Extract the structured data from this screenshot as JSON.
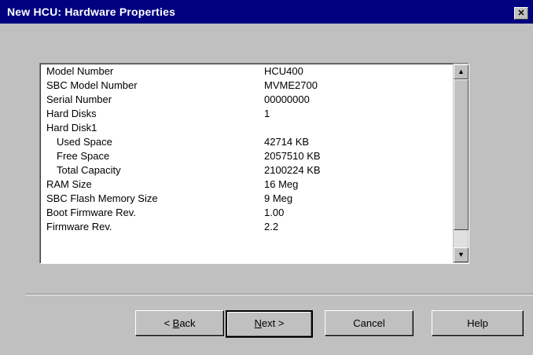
{
  "window": {
    "title": "New HCU: Hardware Properties",
    "close_label": "✕"
  },
  "properties": [
    {
      "label": "Model Number",
      "value": "HCU400",
      "indent": false
    },
    {
      "label": "SBC Model Number",
      "value": "MVME2700",
      "indent": false
    },
    {
      "label": "Serial Number",
      "value": "00000000",
      "indent": false
    },
    {
      "label": "Hard Disks",
      "value": "1",
      "indent": false
    },
    {
      "label": "Hard Disk1",
      "value": "",
      "indent": false
    },
    {
      "label": "Used Space",
      "value": "42714 KB",
      "indent": true
    },
    {
      "label": "Free Space",
      "value": "2057510 KB",
      "indent": true
    },
    {
      "label": "Total Capacity",
      "value": "2100224 KB",
      "indent": true
    },
    {
      "label": "RAM Size",
      "value": "16 Meg",
      "indent": false
    },
    {
      "label": "SBC Flash Memory Size",
      "value": "9 Meg",
      "indent": false
    },
    {
      "label": "Boot Firmware Rev.",
      "value": "1.00",
      "indent": false
    },
    {
      "label": "Firmware Rev.",
      "value": "2.2",
      "indent": false
    }
  ],
  "scrollbar": {
    "up_arrow": "▲",
    "down_arrow": "▼"
  },
  "buttons": {
    "back": {
      "prefix": "< ",
      "mnemonic": "B",
      "rest": "ack"
    },
    "next": {
      "mnemonic": "N",
      "rest": "ext >"
    },
    "cancel": "Cancel",
    "help": "Help"
  }
}
